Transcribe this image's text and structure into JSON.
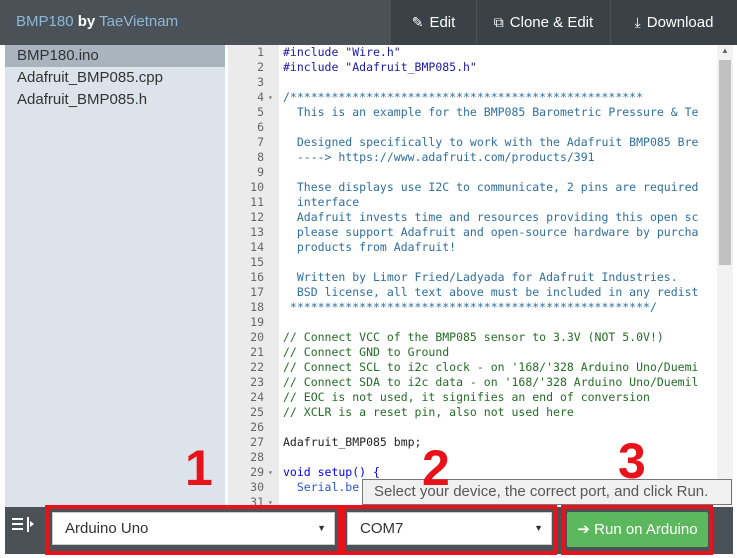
{
  "header": {
    "sketch_name": "BMP180",
    "by": "by",
    "author": "TaeVietnam",
    "buttons": {
      "edit": "Edit",
      "clone": "Clone & Edit",
      "download": "Download"
    }
  },
  "sidebar": {
    "files": [
      "BMP180.ino",
      "Adafruit_BMP085.cpp",
      "Adafruit_BMP085.h"
    ],
    "active_index": 0
  },
  "editor": {
    "lines": [
      {
        "n": "1",
        "fold": "",
        "text": "#include \"Wire.h\"",
        "cls": "c-pre"
      },
      {
        "n": "2",
        "fold": "",
        "text": "#include \"Adafruit_BMP085.h\"",
        "cls": "c-pre"
      },
      {
        "n": "3",
        "fold": "",
        "text": "",
        "cls": "c-plain"
      },
      {
        "n": "4",
        "fold": "▾",
        "text": "/*************************************************** ",
        "cls": "c-com2"
      },
      {
        "n": "5",
        "fold": "",
        "text": "  This is an example for the BMP085 Barometric Pressure & Te",
        "cls": "c-com2"
      },
      {
        "n": "6",
        "fold": "",
        "text": "",
        "cls": "c-com2"
      },
      {
        "n": "7",
        "fold": "",
        "text": "  Designed specifically to work with the Adafruit BMP085 Bre",
        "cls": "c-com2"
      },
      {
        "n": "8",
        "fold": "",
        "text": "  ----> https://www.adafruit.com/products/391",
        "cls": "c-com2"
      },
      {
        "n": "9",
        "fold": "",
        "text": "",
        "cls": "c-com2"
      },
      {
        "n": "10",
        "fold": "",
        "text": "  These displays use I2C to communicate, 2 pins are required",
        "cls": "c-com2"
      },
      {
        "n": "11",
        "fold": "",
        "text": "  interface",
        "cls": "c-com2"
      },
      {
        "n": "12",
        "fold": "",
        "text": "  Adafruit invests time and resources providing this open sc",
        "cls": "c-com2"
      },
      {
        "n": "13",
        "fold": "",
        "text": "  please support Adafruit and open-source hardware by purcha",
        "cls": "c-com2"
      },
      {
        "n": "14",
        "fold": "",
        "text": "  products from Adafruit!",
        "cls": "c-com2"
      },
      {
        "n": "15",
        "fold": "",
        "text": "",
        "cls": "c-com2"
      },
      {
        "n": "16",
        "fold": "",
        "text": "  Written by Limor Fried/Ladyada for Adafruit Industries.",
        "cls": "c-com2"
      },
      {
        "n": "17",
        "fold": "",
        "text": "  BSD license, all text above must be included in any redist",
        "cls": "c-com2"
      },
      {
        "n": "18",
        "fold": "",
        "text": " ****************************************************/",
        "cls": "c-com2"
      },
      {
        "n": "19",
        "fold": "",
        "text": "",
        "cls": "c-plain"
      },
      {
        "n": "20",
        "fold": "",
        "text": "// Connect VCC of the BMP085 sensor to 3.3V (NOT 5.0V!)",
        "cls": "c-com"
      },
      {
        "n": "21",
        "fold": "",
        "text": "// Connect GND to Ground",
        "cls": "c-com"
      },
      {
        "n": "22",
        "fold": "",
        "text": "// Connect SCL to i2c clock - on '168/'328 Arduino Uno/Duemi",
        "cls": "c-com"
      },
      {
        "n": "23",
        "fold": "",
        "text": "// Connect SDA to i2c data - on '168/'328 Arduino Uno/Duemil",
        "cls": "c-com"
      },
      {
        "n": "24",
        "fold": "",
        "text": "// EOC is not used, it signifies an end of conversion",
        "cls": "c-com"
      },
      {
        "n": "25",
        "fold": "",
        "text": "// XCLR is a reset pin, also not used here",
        "cls": "c-com"
      },
      {
        "n": "26",
        "fold": "",
        "text": "",
        "cls": "c-plain"
      },
      {
        "n": "27",
        "fold": "",
        "text": "Adafruit_BMP085 bmp;",
        "cls": "c-plain"
      },
      {
        "n": "28",
        "fold": "",
        "text": "",
        "cls": "c-plain"
      },
      {
        "n": "29",
        "fold": "▾",
        "text": "void setup() {",
        "cls": "c-kw"
      },
      {
        "n": "30",
        "fold": "",
        "text": "  Serial.be",
        "cls": "c-blue"
      },
      {
        "n": "31",
        "fold": "▾",
        "text": "",
        "cls": "c-plain"
      }
    ]
  },
  "tooltip": "Select your device, the correct port, and click Run.",
  "bottom": {
    "board_select": "Arduino Uno",
    "port_select": "COM7",
    "run_button": "Run on Arduino"
  },
  "callouts": [
    "1",
    "2",
    "3"
  ],
  "colors": {
    "header_bg": "#4a5258",
    "sidebar_bg": "#dde3ea",
    "run_green": "#5cb85c",
    "callout_red": "#e8121a"
  }
}
